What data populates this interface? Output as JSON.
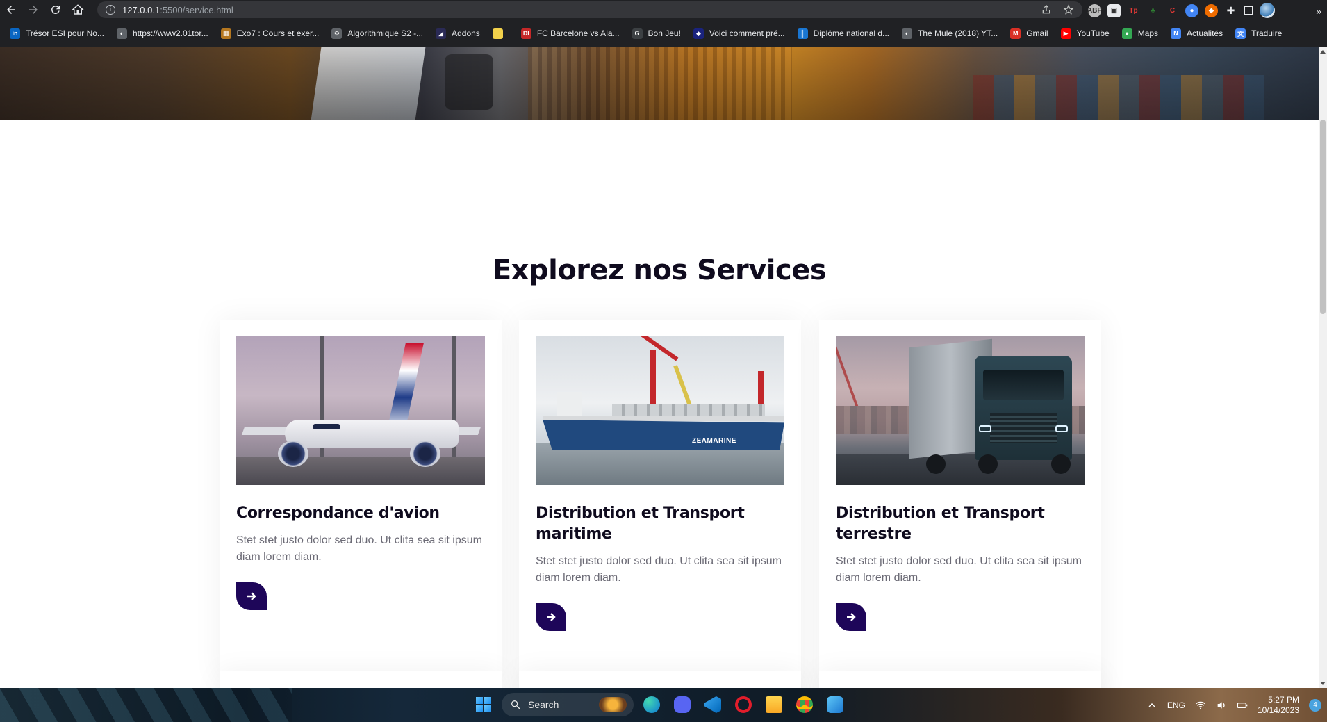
{
  "browser": {
    "url_host": "127.0.0.1",
    "url_path": ":5500/service.html"
  },
  "bookmarks": [
    {
      "label": "Trésor ESI pour No...",
      "icon": "linkedin-icon",
      "color": "#0a66c2",
      "glyph": "in"
    },
    {
      "label": "https://www2.01tor...",
      "icon": "globe-icon",
      "color": "#5f6368",
      "glyph": "◐"
    },
    {
      "label": "Exo7 : Cours et exer...",
      "icon": "grid-icon",
      "color": "#b5771f",
      "glyph": "▦"
    },
    {
      "label": "Algorithmique S2 -...",
      "icon": "gear-icon",
      "color": "#5f6368",
      "glyph": "⚙"
    },
    {
      "label": "Addons",
      "icon": "addons-icon",
      "color": "#2a2a55",
      "glyph": "◢"
    },
    {
      "label": "",
      "icon": "folder-icon",
      "color": "#f2d14b",
      "glyph": ""
    },
    {
      "label": "FC Barcelone vs Ala...",
      "icon": "di-icon",
      "color": "#c62828",
      "glyph": "DI"
    },
    {
      "label": "Bon Jeu!",
      "icon": "google-icon",
      "color": "#3c4043",
      "glyph": "G"
    },
    {
      "label": "Voici comment pré...",
      "icon": "shield-icon",
      "color": "#1a237e",
      "glyph": "◆"
    },
    {
      "label": "Diplôme national d...",
      "icon": "chart-icon",
      "color": "#1976d2",
      "glyph": "║"
    },
    {
      "label": "The Mule (2018) YT...",
      "icon": "globe-icon",
      "color": "#5f6368",
      "glyph": "◐"
    },
    {
      "label": "Gmail",
      "icon": "gmail-icon",
      "color": "#d93025",
      "glyph": "M"
    },
    {
      "label": "YouTube",
      "icon": "youtube-icon",
      "color": "#ff0000",
      "glyph": "▶"
    },
    {
      "label": "Maps",
      "icon": "maps-icon",
      "color": "#34a853",
      "glyph": "●"
    },
    {
      "label": "Actualités",
      "icon": "news-icon",
      "color": "#4285f4",
      "glyph": "N"
    },
    {
      "label": "Traduire",
      "icon": "translate-icon",
      "color": "#4285f4",
      "glyph": "文"
    }
  ],
  "page": {
    "section_title": "Explorez nos Services",
    "cards": [
      {
        "title": "Correspondance d'avion",
        "desc": "Stet stet justo dolor sed duo. Ut clita sea sit ipsum diam lorem diam."
      },
      {
        "title": "Distribution et Transport maritime",
        "desc": "Stet stet justo dolor sed duo. Ut clita sea sit ipsum diam lorem diam."
      },
      {
        "title": "Distribution et Transport terrestre",
        "desc": "Stet stet justo dolor sed duo. Ut clita sea sit ipsum diam lorem diam."
      }
    ],
    "ship_name": "ZEAMARINE"
  },
  "taskbar": {
    "search_label": "Search",
    "language": "ENG",
    "time": "5:27 PM",
    "date": "10/14/2023",
    "notification_count": "4"
  },
  "colors": {
    "accent": "#1e0659",
    "heading": "#0f0b1e",
    "body_text": "#6b6a75"
  }
}
